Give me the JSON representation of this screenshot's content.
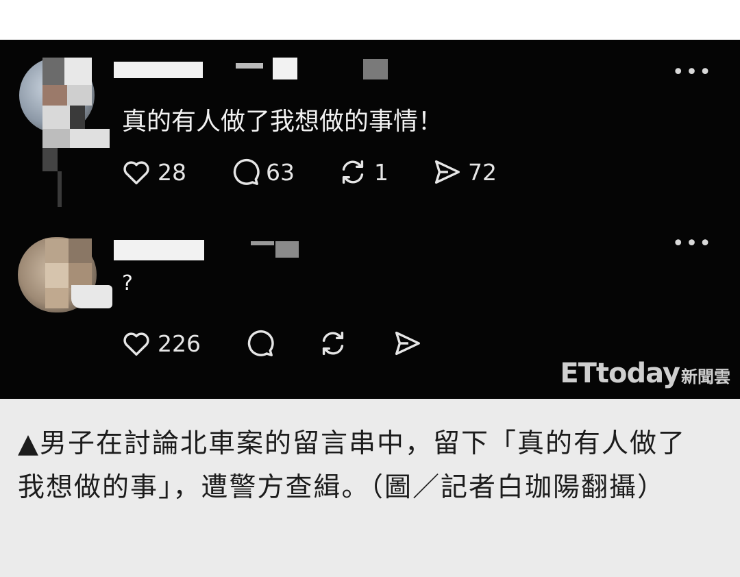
{
  "post": {
    "text": "真的有人做了我想做的事情！",
    "more_label": "•••",
    "likes": "28",
    "comments": "63",
    "reposts": "1",
    "shares": "72"
  },
  "reply": {
    "text": "?",
    "more_label": "•••",
    "likes": "226"
  },
  "watermark": {
    "brand": "ETtoday",
    "sub": "新聞雲"
  },
  "caption": {
    "text": "▲男子在討論北車案的留言串中，留下「真的有人做了我想做的事」，遭警方查緝。（圖／記者白珈陽翻攝）"
  },
  "icons": [
    "heart-icon",
    "comment-icon",
    "repost-icon",
    "share-icon",
    "more-icon"
  ],
  "colors": {
    "screenshot_bg": "#050505",
    "text": "#f2f2f2",
    "caption_bg": "#ebebeb"
  }
}
